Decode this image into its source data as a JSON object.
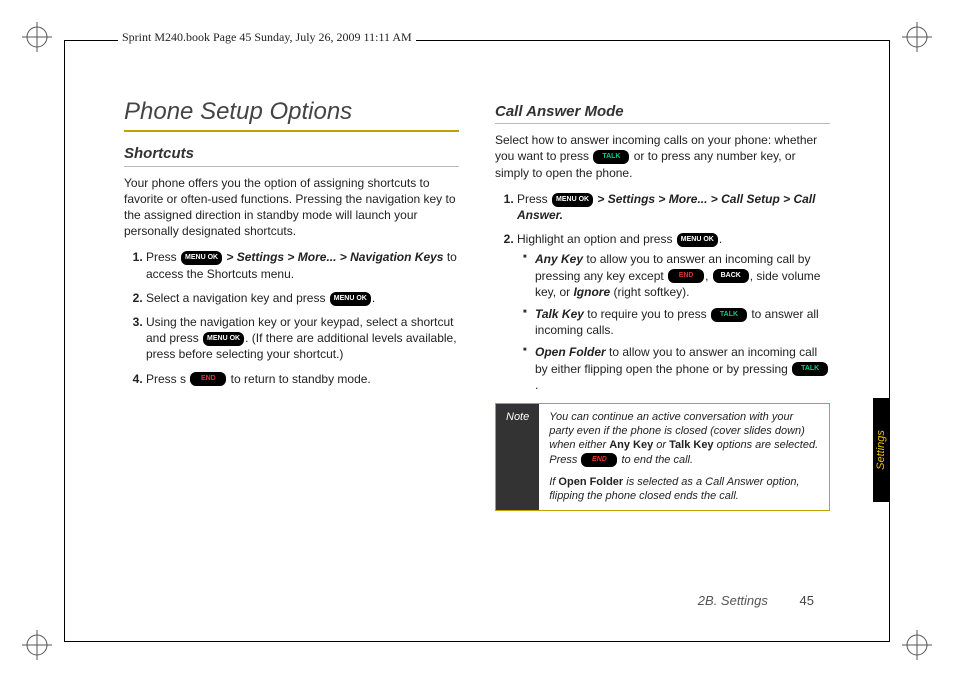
{
  "header": "Sprint M240.book  Page 45  Sunday, July 26, 2009  11:11 AM",
  "keys": {
    "menu": "MENU OK",
    "talk": "TALK",
    "end": "END",
    "back": "BACK"
  },
  "left": {
    "title": "Phone Setup Options",
    "sub1": "Shortcuts",
    "intro": "Your phone offers you the option of assigning shortcuts to favorite or often-used functions. Pressing the navigation key to the assigned direction in standby mode will launch your personally designated shortcuts.",
    "s1_pre": "Press ",
    "s1_path": " > Settings > More... > Navigation Keys",
    "s1_post": " to access the Shortcuts menu.",
    "s2_pre": "Select a navigation key and press ",
    "s3_pre": "Using the navigation key or your keypad, select a shortcut and press ",
    "s3_post": ". (If there are additional levels available, press before selecting your shortcut.)",
    "s4_pre": "Press s ",
    "s4_post": " to return to standby mode."
  },
  "right": {
    "sub": "Call Answer Mode",
    "intro_a": "Select how to answer incoming calls on your phone: whether you want to press ",
    "intro_b": " or to press any number key, or simply to open the phone.",
    "s1_pre": "Press ",
    "s1_path": " > Settings > More... > Call Setup > Call Answer.",
    "s2_pre": "Highlight an option and press ",
    "b1_label": "Any Key",
    "b1_a": " to allow you to answer an incoming call by pressing any key except ",
    "b1_b": ", ",
    "b1_c": ", side volume key, or ",
    "b1_ignore": "Ignore",
    "b1_d": " (right softkey).",
    "b2_label": "Talk Key",
    "b2_a": " to require you to press ",
    "b2_b": " to answer all incoming calls.",
    "b3_label": "Open Folder",
    "b3_a": " to allow you to answer an incoming call by either flipping open the phone or by pressing ",
    "note_label": "Note",
    "note_p1_a": "You can continue an active conversation with your party even if the phone is closed (cover slides down) when either ",
    "note_p1_b": "Any Key",
    "note_p1_c": " or ",
    "note_p1_d": "Talk Key",
    "note_p1_e": " options are selected. Press ",
    "note_p1_f": " to end the call.",
    "note_p2_a": "If ",
    "note_p2_b": "Open Folder",
    "note_p2_c": " is selected as a Call Answer option, flipping the phone closed ends the call."
  },
  "side_tab": "Settings",
  "footer": {
    "section": "2B. Settings",
    "page": "45"
  }
}
